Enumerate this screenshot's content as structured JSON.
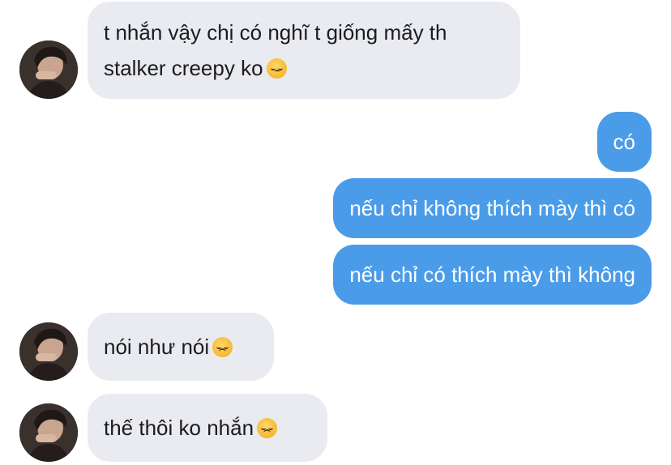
{
  "conversation": {
    "messages": [
      {
        "side": "incoming",
        "lines": [
          "t nhắn vậy chị có nghĩ t giống mấy th",
          "stalker creepy ko"
        ],
        "emoji": "pensive-face"
      },
      {
        "side": "outgoing",
        "text": "có"
      },
      {
        "side": "outgoing",
        "text": "nếu chỉ không thích mày thì có"
      },
      {
        "side": "outgoing",
        "text": "nếu chỉ có thích mày thì không"
      },
      {
        "side": "incoming",
        "text": "nói như nói",
        "emoji": "disappointed-face"
      },
      {
        "side": "incoming",
        "text": "thế thôi ko nhắn",
        "emoji": "disappointed-face"
      }
    ]
  },
  "colors": {
    "incoming_bubble": "#e9ebf0",
    "outgoing_bubble": "#4a9ce8",
    "incoming_text": "#1c1c1e",
    "outgoing_text": "#ffffff",
    "background": "#ffffff"
  },
  "icons": {
    "avatar": "contact-avatar-photo",
    "emoji_pensive": "pensive-face-emoji",
    "emoji_disappointed": "disappointed-face-emoji"
  }
}
